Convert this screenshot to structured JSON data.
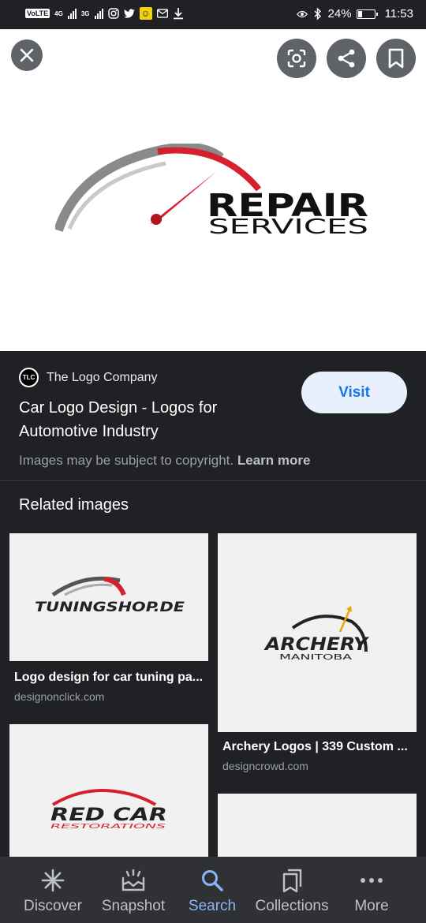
{
  "status_bar": {
    "volte": "VoLTE",
    "net1": "4G",
    "net2": "3G",
    "eye_icon": "eye-icon",
    "bluetooth_icon": "bluetooth-icon",
    "battery": "24%",
    "battery_level": 0.24,
    "time": "11:53"
  },
  "viewer": {
    "close_icon": "close-icon",
    "lens_icon": "google-lens-icon",
    "share_icon": "share-icon",
    "save_icon": "bookmark-icon",
    "logo_text_1": "REPAIR",
    "logo_text_2": "SERVICES"
  },
  "result": {
    "favicon_text": "TLC",
    "source": "The Logo Company",
    "title": "Car Logo Design - Logos for Automotive Industry",
    "visit": "Visit",
    "copyright": "Images may be subject to copyright.",
    "learn_more": "Learn more"
  },
  "related": {
    "heading": "Related images",
    "items": [
      {
        "title": "Logo design for car tuning pa...",
        "domain": "designonclick.com",
        "logo_text": "TUNINGSHOP.DE"
      },
      {
        "title": "Archery Logos | 339 Custom ...",
        "domain": "designcrowd.com",
        "logo_text": "ARCHERY",
        "logo_sub": "MANITOBA"
      },
      {
        "logo_text": "RED CAR",
        "logo_sub": "RESTORATIONS"
      }
    ]
  },
  "nav": {
    "items": [
      {
        "label": "Discover",
        "icon": "asterisk-icon"
      },
      {
        "label": "Snapshot",
        "icon": "snapshot-icon"
      },
      {
        "label": "Search",
        "icon": "search-icon"
      },
      {
        "label": "Collections",
        "icon": "collections-icon"
      },
      {
        "label": "More",
        "icon": "more-dots-icon"
      }
    ],
    "active": "Search"
  },
  "colors": {
    "background": "#202124",
    "accent": "#8ab4f8",
    "visit_bg": "#e8f0fe",
    "visit_text": "#1a73e8",
    "logo_red": "#d6202b"
  }
}
